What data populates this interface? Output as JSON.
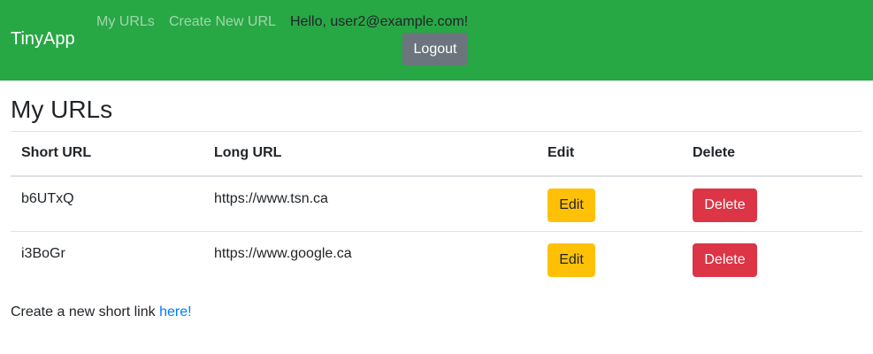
{
  "navbar": {
    "brand": "TinyApp",
    "links": [
      "My URLs",
      "Create New URL"
    ],
    "greeting": "Hello, user2@example.com!",
    "logout_label": "Logout",
    "bg_color": "#28a745"
  },
  "main": {
    "title": "My URLs",
    "table": {
      "headers": [
        "Short URL",
        "Long URL",
        "Edit",
        "Delete"
      ],
      "rows": [
        {
          "short": "b6UTxQ",
          "long": "https://www.tsn.ca",
          "edit": "Edit",
          "delete": "Delete"
        },
        {
          "short": "i3BoGr",
          "long": "https://www.google.ca",
          "edit": "Edit",
          "delete": "Delete"
        }
      ]
    },
    "footer": {
      "text": "Create a new short link",
      "link": "here!"
    }
  },
  "colors": {
    "edit_button": "#ffc107",
    "delete_button": "#dc3545",
    "logout_button": "#6c757d",
    "link": "#007bff"
  }
}
